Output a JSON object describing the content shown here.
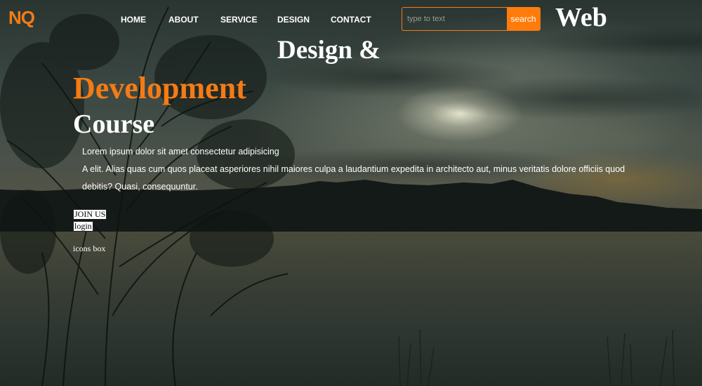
{
  "header": {
    "logo": "NQ",
    "nav": [
      "HOME",
      "ABOUT",
      "SERVICE",
      "DESIGN",
      "CONTACT"
    ],
    "search": {
      "placeholder": "type to text",
      "button_label": "search"
    }
  },
  "hero": {
    "line_web": "Web",
    "line_design": "Design &",
    "line_development": "Development",
    "line_course": "Course",
    "paragraph_line1": "Lorem ipsum dolor sit amet consectetur adipisicing",
    "paragraph_line2": "A elit. Alias quas cum quos placeat asperiores nihil maiores culpa a laudantium expedita in architecto aut, minus veritatis dolore officiis quod",
    "paragraph_line3": "debitis? Quasi, consequuntur.",
    "join_label": "JOIN US",
    "login_label": "login",
    "icons_box_label": "icons box"
  },
  "colors": {
    "accent": "#f47b15",
    "search_button": "#ff7c0c",
    "text": "#ffffff"
  }
}
